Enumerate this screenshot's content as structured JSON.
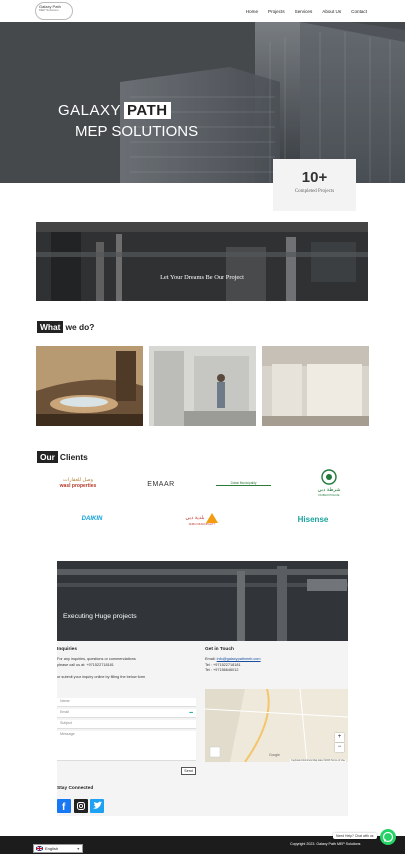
{
  "logo": {
    "line1": "Galaxy Path",
    "line2": "MEP Solutions"
  },
  "nav": [
    {
      "label": "Home"
    },
    {
      "label": "Projects"
    },
    {
      "label": "Services"
    },
    {
      "label": "About Us"
    },
    {
      "label": "Contact"
    }
  ],
  "hero": {
    "title_part1": "GALAXY",
    "title_part2": "PATH",
    "subtitle": "MEP SOLUTIONS"
  },
  "stat": {
    "number": "10+",
    "label": "Completed Projects"
  },
  "banner": {
    "text": "Let Your Dreams Be Our Project"
  },
  "what": {
    "highlight": "What",
    "rest": "we do?"
  },
  "clients": {
    "highlight": "Our",
    "rest": "Clients",
    "logos": [
      {
        "name": "wasl properties",
        "arabic": "وصل للعقارات"
      },
      {
        "name": "EMAAR"
      },
      {
        "name": "Dubai Municipality"
      },
      {
        "name": "DUBAI POLICE",
        "arabic": "شرطة دبي"
      },
      {
        "name": "DAIKIN"
      },
      {
        "name": "DUBAI MUNICIPALITY",
        "arabic": "بلدية دبي"
      },
      {
        "name": "Hisense"
      }
    ]
  },
  "contact": {
    "image_text": "Executing Huge projects",
    "inquiries": {
      "heading": "Inquiries",
      "line1": "For any inquiries, questions or commendations",
      "line2": "please call us at: +971522718181",
      "line3": "or submit your inquiry online by filling the below form"
    },
    "form": {
      "name": "Name",
      "email": "Email",
      "subject": "Subject",
      "message": "Message",
      "send": "Send"
    },
    "touch": {
      "heading": "Get in Touch",
      "email_label": "Email:",
      "email": "info@galaxypathmeb.com",
      "tel1": "Tel : +971522718181",
      "tel2": "Tel : +97156646012"
    },
    "map": {
      "zoom_in": "+",
      "zoom_out": "−",
      "google": "Google",
      "attribution": "Keyboard shortcuts   Map data ©2023   Terms of Use"
    },
    "stay": "Stay Connected"
  },
  "footer": {
    "language": "English",
    "copyright": "Copyright 2023. Galaxy Path MEP Solutions",
    "whatsapp_tip": "Need Help? Chat with us"
  },
  "colors": {
    "accent": "#222222",
    "whatsapp": "#25d366",
    "facebook": "#1877f2",
    "instagram": "#222222",
    "twitter": "#1da1f2"
  }
}
